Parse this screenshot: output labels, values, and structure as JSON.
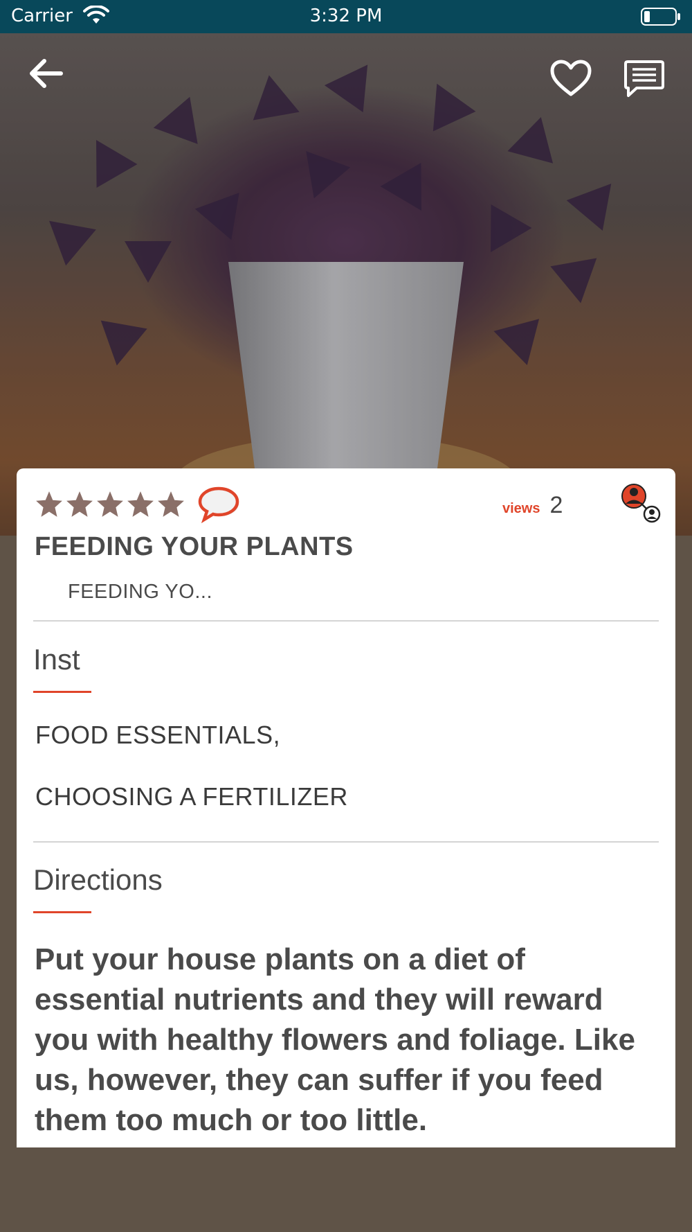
{
  "status_bar": {
    "carrier": "Carrier",
    "time": "3:32 PM"
  },
  "hero": {
    "back_icon": "arrow-left-icon",
    "favorite_icon": "heart-icon",
    "chat_icon": "message-icon"
  },
  "card": {
    "rating": {
      "stars": 5,
      "max": 5,
      "star_color": "#8a6f68"
    },
    "comment_icon": "speech-bubble-icon",
    "views_label": "views",
    "views_count": "2",
    "users_icon": "users-icon",
    "title": "FEEDING YOUR PLANTS",
    "subtitle": "FEEDING YO...",
    "inst_heading": "Inst",
    "inst_items": [
      "FOOD ESSENTIALS,",
      "CHOOSING A FERTILIZER"
    ],
    "directions_heading": "Directions",
    "directions_text": "Put your house plants on a diet of essential nutrients and they will reward you with healthy flowers and foliage. Like us, however, they can suffer if you feed them too much or too little."
  },
  "colors": {
    "status_bar": "#08485a",
    "accent": "#e0452a",
    "page_bg": "#5f5347"
  }
}
